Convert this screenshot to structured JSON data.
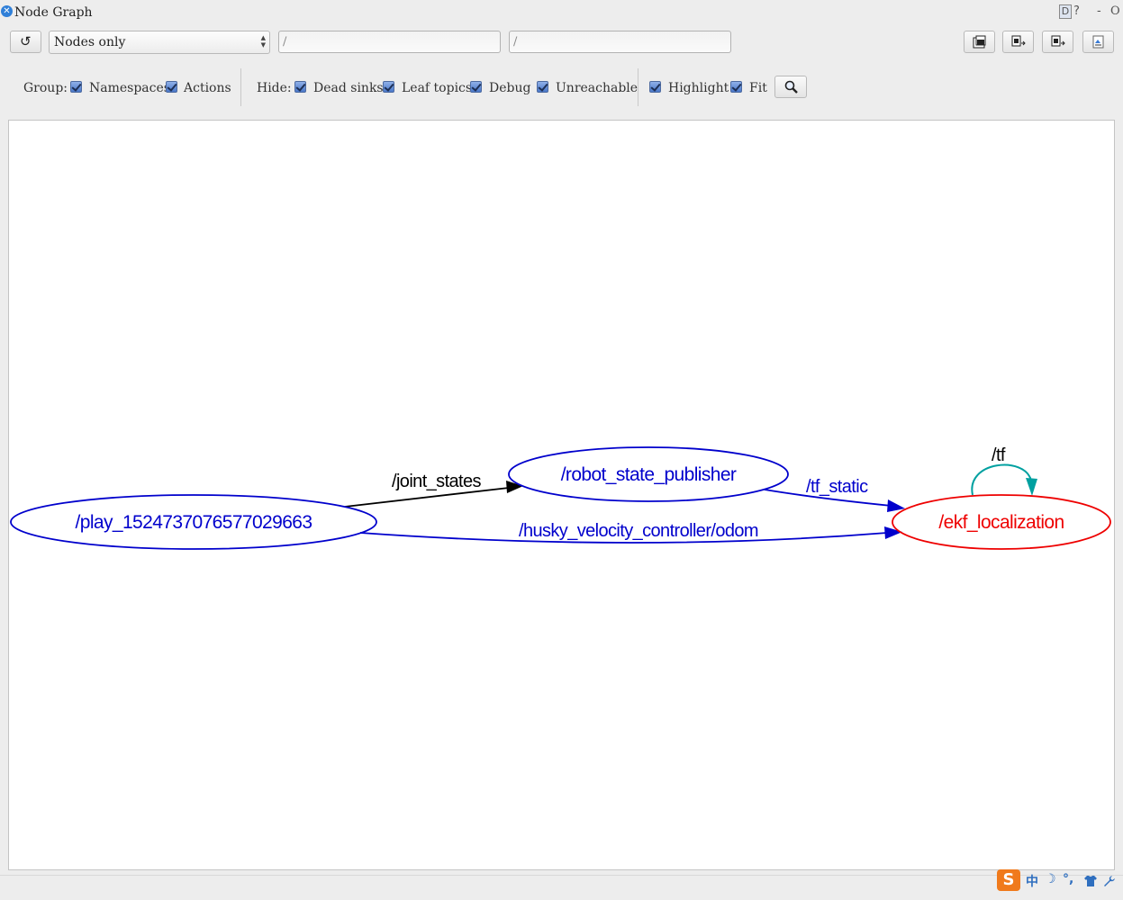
{
  "window": {
    "title": "Node Graph",
    "right_icons": [
      "D",
      "?",
      "-",
      "O"
    ]
  },
  "toolbar": {
    "refresh_icon": "refresh-icon",
    "graph_type": "Nodes only",
    "node_filter": "/",
    "topic_filter": "/",
    "tool_icons": [
      "load-dot-icon",
      "save-dot-icon",
      "save-svg-icon",
      "save-image-icon"
    ]
  },
  "options": {
    "group_label": "Group:",
    "group": [
      {
        "label": "Namespaces",
        "checked": true
      },
      {
        "label": "Actions",
        "checked": true
      }
    ],
    "hide_label": "Hide:",
    "hide": [
      {
        "label": "Dead sinks",
        "checked": true
      },
      {
        "label": "Leaf topics",
        "checked": true
      },
      {
        "label": "Debug",
        "checked": true
      },
      {
        "label": "Unreachable",
        "checked": true
      }
    ],
    "view": [
      {
        "label": "Highlight",
        "checked": true
      },
      {
        "label": "Fit",
        "checked": true
      }
    ],
    "zoom_icon": "magnifier-icon"
  },
  "graph": {
    "nodes": [
      {
        "id": "play",
        "label": "/play_1524737076577029663",
        "color": "#0000cc"
      },
      {
        "id": "rsp",
        "label": "/robot_state_publisher",
        "color": "#0000cc"
      },
      {
        "id": "ekf",
        "label": "/ekf_localization",
        "color": "#ee0000"
      }
    ],
    "edges": [
      {
        "from": "play",
        "to": "rsp",
        "label": "/joint_states",
        "color": "#000000"
      },
      {
        "from": "rsp",
        "to": "ekf",
        "label": "/tf_static",
        "color": "#0000cc"
      },
      {
        "from": "play",
        "to": "ekf",
        "label": "/husky_velocity_controller/odom",
        "color": "#0000cc"
      },
      {
        "from": "ekf",
        "to": "ekf",
        "label": "/tf",
        "color": "#00a0a0",
        "label_color": "#000000"
      }
    ]
  },
  "status_tray": {
    "ime_logo": "S",
    "items": [
      "中",
      "☽",
      "°,",
      "shirt-icon",
      "wrench-icon"
    ]
  }
}
